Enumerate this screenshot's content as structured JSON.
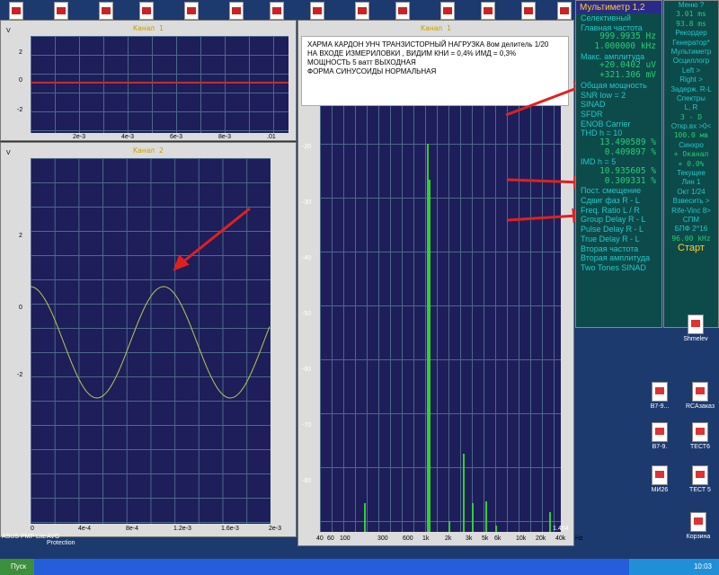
{
  "top_icons": [
    10,
    60,
    110,
    155,
    205,
    255,
    300,
    345,
    395,
    440,
    490,
    535,
    580,
    620
  ],
  "ch1": {
    "title": "Канал 1",
    "yunit": "V",
    "yticks": [
      "2",
      "0",
      "-2"
    ],
    "xticks": [
      "2e-3",
      "4e-3",
      "6e-3",
      "8e-3",
      ".01",
      "s"
    ]
  },
  "ch2": {
    "title": "Канал 2",
    "yunit": "V",
    "yticks": [
      "2",
      "0",
      "-2"
    ],
    "xticks": [
      "0",
      "4e-4",
      "8e-4",
      "1.2e-3",
      "1.6e-3",
      "2e-3",
      "s"
    ]
  },
  "spec": {
    "title": "Канал 1",
    "yticks": [
      "-10",
      "-20",
      "-30",
      "-40",
      "-50",
      "-60",
      "-70",
      "-80"
    ],
    "xticks": [
      "40",
      "60",
      "100",
      "300",
      "600",
      "1k",
      "2k",
      "3k",
      "5k",
      "6k",
      "10k",
      "20k",
      "40k",
      "Hz"
    ],
    "bottom_val": "1.464"
  },
  "note": {
    "line1": "ХАРМА КАРДОН УНЧ ТРАНЗИСТОРНЫЙ НАГРУЗКА 8ом делитель 1/20",
    "line2": "НА ВХОДЕ ИЗМЕРИЛОВКИ , ВИДИМ КНИ = 0,4%  ИМД = 0,3%",
    "line3": "МОЩНОСТЬ  5 ватт ВЫХОДНАЯ",
    "line4": "ФОРМА СИНУСОИДЫ НОРМАЛЬНАЯ"
  },
  "meter": {
    "title": "Мультиметр 1,2",
    "rows": [
      "Селективный",
      "Главная частота",
      "999.9935 Hz",
      "1.000000 kHz",
      "Макс. амплитуда",
      "+20.0402 uV",
      "+321.306 mV",
      "Общая мощность",
      "SNR      low =   2",
      "SINAD",
      "SFDR",
      "ENOB  Carrier",
      "THD      h = 10",
      "13.490589 %",
      "0.409897 %",
      "IMD       h =  5",
      "10.935605 %",
      "0.309331 %",
      "Пост. смещение",
      "Сдвиг фаз R - L",
      "Freq. Ratio  L / R",
      "Group Delay R - L",
      "Pulse Delay R - L",
      "True Delay R - L",
      "Вторая частота",
      "Вторая амплитуда",
      "Two Tones SINAD"
    ]
  },
  "side": {
    "rows": [
      "Меню  ?",
      "3.01 ms",
      "93.8 ms",
      "Рекордер",
      "Генератор*",
      "Мультиметр",
      "Осциллогр",
      "Left  >",
      "Right  >",
      "Задерж. R-L",
      "Спектры",
      "L, R",
      "3 - D",
      "Откр.вх >0<",
      "100.0 мв",
      "Синхро",
      "+ Оканал",
      "+  0.0%",
      "Текущее",
      "Лин  1",
      "Окт  1/24",
      "Взвесить >",
      "Rife-Vinc 8>",
      "СПМ",
      "БПФ  2^16",
      "96.00 kHz",
      "Старт"
    ]
  },
  "desktop_icons": [
    {
      "label": "В7-9..."
    },
    {
      "label": "RCAзаказ"
    },
    {
      "label": "В7-9."
    },
    {
      "label": "ТЕСТ6"
    },
    {
      "label": "МИ26"
    },
    {
      "label": "ТЕСТ 5"
    },
    {
      "label": "Корзина"
    },
    {
      "label": "Shmelev"
    }
  ],
  "bottom_labels": {
    "asus": "ASUS PMP Lite",
    "avg": "AVG\nProtection"
  },
  "taskbar": {
    "start": "Пуск",
    "lang": "RU",
    "clock": "10:03"
  }
}
